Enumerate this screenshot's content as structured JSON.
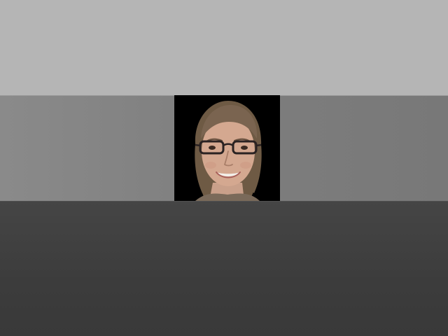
{
  "scene": {
    "colors": {
      "ceiling": "#b5b5b5",
      "wall": "#808080",
      "floor": "#3e3e3e",
      "portrait_background": "#000000"
    },
    "portrait": {
      "subject": "woman-with-glasses",
      "icon": "portrait-photo"
    }
  }
}
